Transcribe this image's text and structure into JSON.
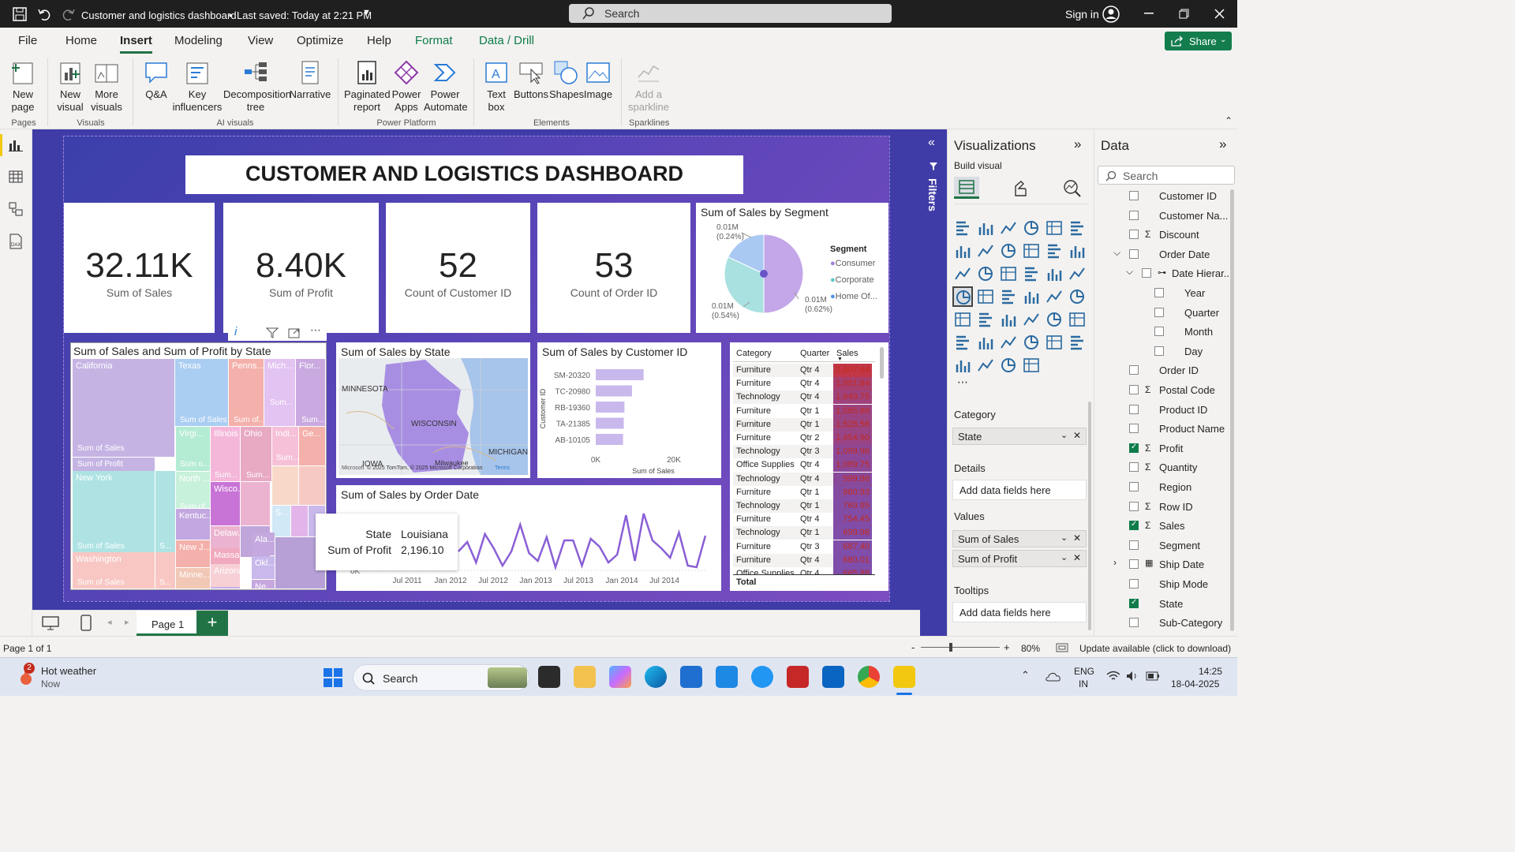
{
  "titlebar": {
    "doc_title": "Customer and logistics dashboard",
    "saved": "Last saved: Today at 2:21 PM",
    "search_placeholder": "Search",
    "sign_in": "Sign in"
  },
  "menu": {
    "items": [
      "File",
      "Home",
      "Insert",
      "Modeling",
      "View",
      "Optimize",
      "Help",
      "Format",
      "Data / Drill"
    ],
    "active": "Insert",
    "share": "Share"
  },
  "ribbon": {
    "buttons": {
      "new_page": "New page",
      "new_visual": "New visual",
      "more_visuals": "More visuals",
      "qa": "Q&A",
      "key_influencers": "Key influencers",
      "decomposition_tree": "Decomposition tree",
      "narrative": "Narrative",
      "paginated_report": "Paginated report",
      "power_apps": "Power Apps",
      "power_automate": "Power Automate",
      "text_box": "Text box",
      "buttons": "Buttons",
      "shapes": "Shapes",
      "image": "Image",
      "add_sparkline": "Add a sparkline"
    },
    "groups": {
      "pages": "Pages",
      "visuals": "Visuals",
      "ai_visuals": "AI visuals",
      "power_platform": "Power Platform",
      "elements": "Elements",
      "sparklines": "Sparklines"
    }
  },
  "dashboard": {
    "title": "CUSTOMER AND LOGISTICS DASHBOARD",
    "kpis": [
      {
        "value": "32.11K",
        "label": "Sum of Sales"
      },
      {
        "value": "8.40K",
        "label": "Sum of Profit"
      },
      {
        "value": "52",
        "label": "Count of Customer ID"
      },
      {
        "value": "53",
        "label": "Count of Order ID"
      }
    ],
    "segment_title": "Sum of Sales by Segment",
    "segment_legend_title": "Segment",
    "treemap_title": "Sum of Sales and Sum of Profit by State",
    "map_title": "Sum of Sales by State",
    "customer_title": "Sum of Sales by Customer ID",
    "orderdate_title": "Sum of Sales by Order Date",
    "tooltip": {
      "k1": "State",
      "v1": "Louisiana",
      "k2": "Sum of Profit",
      "v2": "2,196.10"
    },
    "treemap_cells": {
      "california": "California",
      "texas": "Texas",
      "penns": "Penns...",
      "mich": "Mich...",
      "flor": "Flor...",
      "newyork": "New York",
      "virgi": "Virgi...",
      "illinois": "Illinois",
      "ohio": "Ohio",
      "indi": "Indi...",
      "ge": "Ge...",
      "north": "North ...",
      "wisco": "Wisco...",
      "delaw": "Delaw...",
      "kentuc": "Kentuc...",
      "massa": "Massa...",
      "ala": "Ala...",
      "newj": "New J...",
      "arizona": "Arizona",
      "okl": "Okl...",
      "washington": "Washington",
      "minne": "Minne...",
      "color": "Color...",
      "ne": "Ne...",
      "s": "S...",
      "sum_sales": "Sum of Sales",
      "sum_profit": "Sum of Profit",
      "sum_of": "Sum of...",
      "sum_short": "Sum...",
      "sum_o": "Sum o..."
    },
    "map_labels": {
      "minnesota": "MINNESOTA",
      "wisconsin": "WISCONSIN",
      "michigan": "MICHIGAN",
      "iowa": "IOWA",
      "milwaukee": "Milwaukee",
      "copyright": "© 2025 TomTom, © 2025 Microsoft Corporation",
      "terms": "Terms",
      "ms": "Microsoft"
    },
    "table": {
      "headers": [
        "Category",
        "Quarter",
        "Sales"
      ],
      "rows": [
        [
          "Furniture",
          "Qtr 4",
          "2,807.84"
        ],
        [
          "Furniture",
          "Qtr 4",
          "1,951.84"
        ],
        [
          "Technology",
          "Qtr 4",
          "1,649.75"
        ],
        [
          "Furniture",
          "Qtr 1",
          "1,565.88"
        ],
        [
          "Furniture",
          "Qtr 1",
          "1,526.56"
        ],
        [
          "Furniture",
          "Qtr 2",
          "1,454.90"
        ],
        [
          "Technology",
          "Qtr 3",
          "1,099.96"
        ],
        [
          "Office Supplies",
          "Qtr 4",
          "1,089.75"
        ],
        [
          "Technology",
          "Qtr 4",
          "999.96"
        ],
        [
          "Furniture",
          "Qtr 1",
          "860.93"
        ],
        [
          "Technology",
          "Qtr 1",
          "769.95"
        ],
        [
          "Furniture",
          "Qtr 4",
          "754.45"
        ],
        [
          "Technology",
          "Qtr 1",
          "699.98"
        ],
        [
          "Furniture",
          "Qtr 3",
          "687.40"
        ],
        [
          "Furniture",
          "Qtr 4",
          "680.01"
        ],
        [
          "Office Supplies",
          "Qtr 4",
          "665.88"
        ]
      ],
      "total": "Total"
    }
  },
  "chart_data": [
    {
      "type": "pie",
      "title": "Sum of Sales by Segment",
      "legend_title": "Segment",
      "categories": [
        "Consumer",
        "Corporate",
        "Home Of..."
      ],
      "values": [
        0.01,
        0.01,
        0.01
      ],
      "data_labels": [
        "0.01M\n(0.62%)",
        "0.01M\n(0.54%)",
        "0.01M\n(0.24%)"
      ],
      "colors": [
        "#c3a7e8",
        "#a9e1e1",
        "#a9c8f2"
      ],
      "legend_position": "right"
    },
    {
      "type": "bar",
      "title": "Sum of Sales by Customer ID",
      "categories": [
        "SM-20320",
        "TC-20980",
        "RB-19360",
        "TA-21385",
        "AB-10105"
      ],
      "values": [
        3500,
        2650,
        2100,
        2050,
        2000
      ],
      "xlabel": "Sum of Sales",
      "ylabel": "Customer ID",
      "xticks": [
        "0K",
        "20K"
      ],
      "xlim": [
        0,
        20000
      ]
    },
    {
      "type": "line",
      "title": "Sum of Sales by Order Date",
      "x": [
        "Jul 2011",
        "Jan 2012",
        "Jul 2012",
        "Jan 2013",
        "Jul 2013",
        "Jan 2014",
        "Jul 2014"
      ],
      "ytick": "0K",
      "values": [
        600,
        900,
        250,
        1150,
        700,
        150,
        600,
        1450,
        550,
        300,
        1050,
        100,
        950,
        950,
        150,
        1000,
        750,
        250,
        500,
        1750,
        300,
        1800,
        950,
        700,
        400,
        1200,
        150,
        100,
        1100
      ]
    }
  ],
  "visualizations_panel": {
    "title": "Visualizations",
    "build_visual": "Build visual",
    "wells": {
      "category": "Category",
      "category_field": "State",
      "details": "Details",
      "details_drop": "Add data fields here",
      "values": "Values",
      "values_fields": [
        "Sum of Sales",
        "Sum of Profit"
      ],
      "tooltips": "Tooltips",
      "tooltips_drop": "Add data fields here"
    },
    "filters_label": "Filters"
  },
  "data_panel": {
    "title": "Data",
    "search_placeholder": "Search",
    "fields": [
      {
        "name": "Customer ID",
        "checked": false,
        "sigma": false,
        "level": 0
      },
      {
        "name": "Customer Na...",
        "checked": false,
        "sigma": false,
        "level": 0
      },
      {
        "name": "Discount",
        "checked": false,
        "sigma": true,
        "level": 0
      },
      {
        "name": "Order Date",
        "checked": false,
        "sigma": false,
        "level": 0,
        "expanded": true
      },
      {
        "name": "Date Hierar...",
        "checked": false,
        "sigma": false,
        "level": 1,
        "expanded": true
      },
      {
        "name": "Year",
        "checked": false,
        "sigma": false,
        "level": 2
      },
      {
        "name": "Quarter",
        "checked": false,
        "sigma": false,
        "level": 2
      },
      {
        "name": "Month",
        "checked": false,
        "sigma": false,
        "level": 2
      },
      {
        "name": "Day",
        "checked": false,
        "sigma": false,
        "level": 2
      },
      {
        "name": "Order ID",
        "checked": false,
        "sigma": false,
        "level": 0
      },
      {
        "name": "Postal Code",
        "checked": false,
        "sigma": true,
        "level": 0
      },
      {
        "name": "Product ID",
        "checked": false,
        "sigma": false,
        "level": 0
      },
      {
        "name": "Product Name",
        "checked": false,
        "sigma": false,
        "level": 0
      },
      {
        "name": "Profit",
        "checked": true,
        "sigma": true,
        "level": 0
      },
      {
        "name": "Quantity",
        "checked": false,
        "sigma": true,
        "level": 0
      },
      {
        "name": "Region",
        "checked": false,
        "sigma": false,
        "level": 0
      },
      {
        "name": "Row ID",
        "checked": false,
        "sigma": true,
        "level": 0
      },
      {
        "name": "Sales",
        "checked": true,
        "sigma": true,
        "level": 0
      },
      {
        "name": "Segment",
        "checked": false,
        "sigma": false,
        "level": 0
      },
      {
        "name": "Ship Date",
        "checked": false,
        "sigma": false,
        "level": 0,
        "collapsed": true
      },
      {
        "name": "Ship Mode",
        "checked": false,
        "sigma": false,
        "level": 0
      },
      {
        "name": "State",
        "checked": true,
        "sigma": false,
        "level": 0
      },
      {
        "name": "Sub-Category",
        "checked": false,
        "sigma": false,
        "level": 0
      }
    ]
  },
  "pagebar": {
    "tab": "Page 1",
    "add": "+"
  },
  "status": {
    "page": "Page 1 of 1",
    "zoom": "80%",
    "update": "Update available (click to download)",
    "minus": "-",
    "plus": "+"
  },
  "taskbar": {
    "weather_title": "Hot weather",
    "weather_sub": "Now",
    "weather_badge": "2",
    "search": "Search",
    "lang1": "ENG",
    "lang2": "IN",
    "time": "14:25",
    "date": "18-04-2025"
  }
}
